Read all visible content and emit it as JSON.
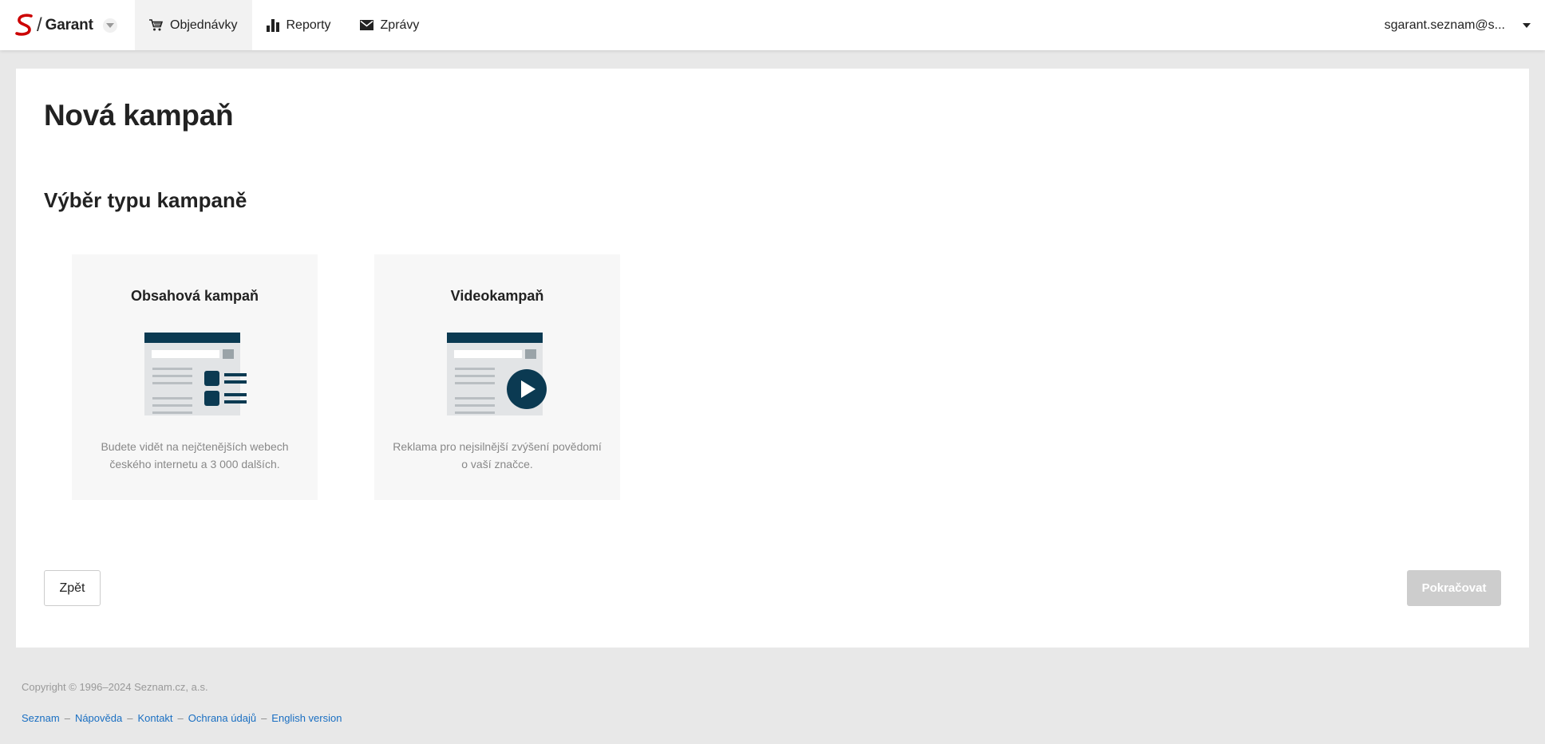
{
  "header": {
    "brand_name": "Garant",
    "brand_slash": "/",
    "nav": [
      {
        "label": "Objednávky",
        "icon": "cart-icon",
        "active": true
      },
      {
        "label": "Reporty",
        "icon": "bar-chart-icon",
        "active": false
      },
      {
        "label": "Zprávy",
        "icon": "envelope-icon",
        "active": false
      }
    ],
    "user_email": "sgarant.seznam@s..."
  },
  "main": {
    "page_title": "Nová kampaň",
    "section_title": "Výběr typu kampaně",
    "cards": [
      {
        "title": "Obsahová kampaň",
        "description": "Budete vidět na nejčtenějších webech českého internetu a 3 000 dalších."
      },
      {
        "title": "Videokampaň",
        "description": "Reklama pro nejsilnější zvýšení povědomí o vaší značce."
      }
    ],
    "back_label": "Zpět",
    "continue_label": "Pokračovat"
  },
  "footer": {
    "copyright": "Copyright © 1996–2024 Seznam.cz, a.s.",
    "links": [
      "Seznam",
      "Nápověda",
      "Kontakt",
      "Ochrana údajů",
      "English version"
    ],
    "separator": "–"
  },
  "colors": {
    "illustration_dark": "#0b3a52",
    "link": "#1a6fc2",
    "logo_red": "#cc0000",
    "disabled_button": "#cdcdcd"
  }
}
